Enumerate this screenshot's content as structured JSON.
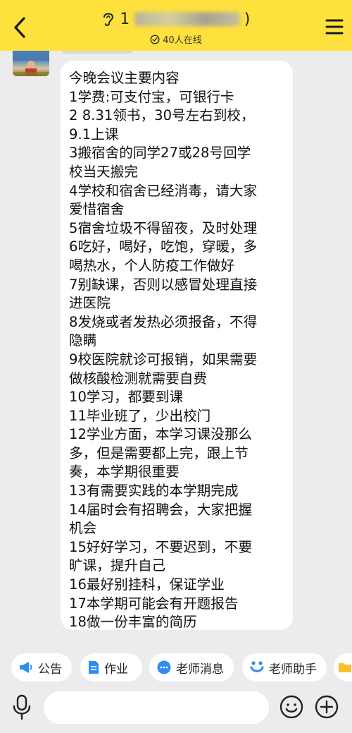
{
  "header": {
    "title_prefix": "1",
    "title_suffix": ")",
    "online": "40人在线"
  },
  "message": {
    "text": "今晚会议主要内容\n1学费:可支付宝，可银行卡\n2 8.31领书，30号左右到校，\n9.1上课\n3搬宿舍的同学27或28号回学\n校当天搬完\n4学校和宿舍已经消毒，请大家\n爱惜宿舍\n5宿舍垃圾不得留夜，及时处理\n6吃好，喝好，吃饱，穿暖，多\n喝热水，个人防疫工作做好\n7别缺课，否则以感冒处理直接\n进医院\n8发烧或者发热必须报备，不得\n隐瞒\n9校医院就诊可报销，如果需要\n做核酸检测就需要自费\n10学习，都要到课\n11毕业班了，少出校门\n12学业方面，本学习课没那么\n多，但是需要都上完，跟上节\n奏，本学期很重要\n13有需要实践的本学期完成\n14届时会有招聘会，大家把握\n机会\n15好好学习，不要迟到，不要\n旷课，提升自己\n16最好别挂科，保证学业\n17本学期可能会有开题报告\n18做一份丰富的简历"
  },
  "quickbar": {
    "announcement": "公告",
    "homework": "作业",
    "teacher_messages": "老师消息",
    "teacher_assistant": "老师助手"
  },
  "colors": {
    "header_bg": "#ffe13d",
    "chat_bg": "#ececec",
    "bubble_bg": "#ffffff",
    "chip_icon_blue": "#2f8cf5"
  },
  "icons": {
    "back": "chevron-left-icon",
    "ear": "ear-icon",
    "online": "check-circle-icon",
    "menu": "hamburger-icon",
    "mic": "microphone-icon",
    "emoji": "smiley-icon",
    "plus": "plus-circle-icon"
  }
}
